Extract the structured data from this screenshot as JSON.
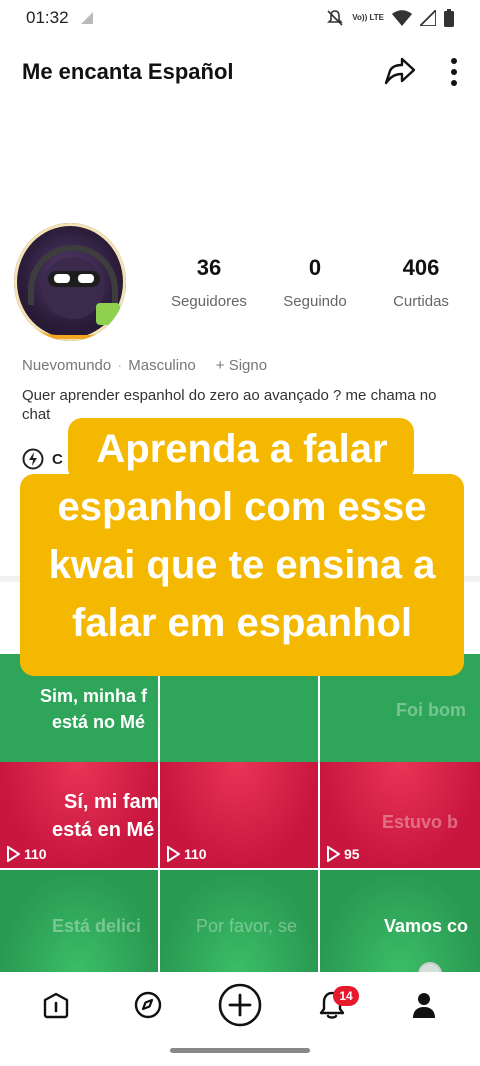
{
  "status_bar": {
    "time": "01:32",
    "network": "Vo)) LTE"
  },
  "header": {
    "title": "Me encanta Español"
  },
  "profile": {
    "stats": [
      {
        "value": "36",
        "label": "Seguidores"
      },
      {
        "value": "0",
        "label": "Seguindo"
      },
      {
        "value": "406",
        "label": "Curtidas"
      }
    ],
    "tags": [
      "Nuevomundo",
      "Masculino",
      "+ Signo"
    ],
    "bio": "Quer aprender espanhol do zero ao avançado ? me chama no chat",
    "chat_label": "C"
  },
  "overlay_text": [
    "Aprenda a falar",
    "espanhol com esse",
    "kwai que te ensina a",
    "falar em espanhol"
  ],
  "videos": [
    {
      "caption_top": "Sim, minha f",
      "caption_top2": "está no Mé",
      "caption_bottom": "Sí, mi fam",
      "caption_bottom2": "está en Mé",
      "views": "110"
    },
    {
      "caption_top": "",
      "caption_top2": "",
      "caption_bottom": "",
      "caption_bottom2": "",
      "views": "110"
    },
    {
      "caption_top": "Foi bom",
      "caption_top2": "",
      "caption_bottom": "Estuvo b",
      "caption_bottom2": "",
      "views": "95"
    },
    {
      "caption": "Está delici"
    },
    {
      "caption": "Por favor, se"
    },
    {
      "caption": "Vamos co"
    }
  ],
  "bottom_nav": {
    "notification_count": "14",
    "items": [
      "home-icon",
      "discover-icon",
      "create-icon",
      "notifications-icon",
      "profile-icon"
    ]
  },
  "colors": {
    "accent": "#f5b800",
    "green": "#2fa55a",
    "red": "#c8163e",
    "badge": "#e8192c"
  }
}
